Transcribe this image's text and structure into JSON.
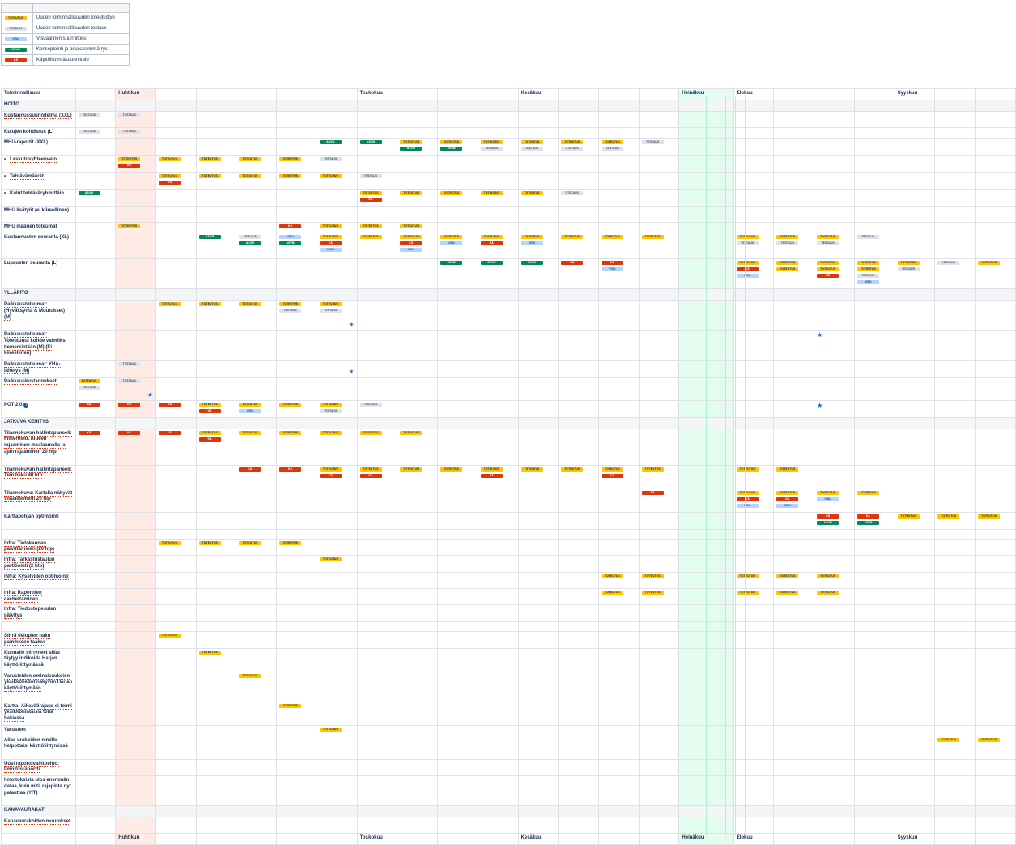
{
  "legend": [
    {
      "key": "T",
      "tag": "TOTEUTUS",
      "text": "Uuden toiminnallisuuden toteutustyö"
    },
    {
      "key": "S",
      "tag": "TESTAUS",
      "text": "Uuden toiminnallisuuden testaus"
    },
    {
      "key": "V",
      "tag": "VISU",
      "text": "Visuaalinen suunnittelu"
    },
    {
      "key": "A",
      "tag": "ASVM",
      "text": "Konseptointi ja asiakasymmärrys"
    },
    {
      "key": "K",
      "tag": "KÄ",
      "text": "Käyttöliittymäsuunnittelu"
    }
  ],
  "tags": {
    "T": "TOTEUTUS",
    "S": "TESTAUS",
    "V": "VISU",
    "A": "ASVM",
    "K": "KÄ"
  },
  "header": {
    "first_col": "Toiminnallisuus",
    "months": [
      "",
      "",
      "Huhtikuu",
      "",
      "",
      "",
      "",
      "",
      "Toukokuu",
      "",
      "",
      "",
      "Kesäkuu",
      "",
      "",
      "",
      "Heinäkuu",
      "Elokuu",
      "",
      "",
      "",
      "Syyskuu",
      "",
      ""
    ]
  },
  "rows": [
    {
      "type": "sec",
      "label": "HOITO"
    },
    {
      "label": "Kustannussuunnitelma (XXL)",
      "link": true,
      "h": 20,
      "cells": {
        "0": [
          "S"
        ],
        "1": [
          "S"
        ]
      }
    },
    {
      "label": "Kulujen kohdistus (L)",
      "h": 13,
      "cells": {
        "0": [
          "S"
        ],
        "1": [
          "S"
        ]
      }
    },
    {
      "label": "MHU-raportit (XXL)",
      "h": 20,
      "cells": {
        "6": [
          "A"
        ],
        "7": [
          "A"
        ],
        "8": [
          "T",
          "A"
        ],
        "9": [
          "T",
          "A"
        ],
        "10": [
          "T",
          "S"
        ],
        "11": [
          "T",
          "S"
        ],
        "12": [
          "T",
          "S"
        ],
        "13": [
          "T",
          "S"
        ],
        "14": [
          "S"
        ]
      }
    },
    {
      "label": "Laskutusyhteenveto",
      "link": true,
      "bullet": true,
      "h": 21,
      "cells": {
        "1": [
          "T",
          "K"
        ],
        "2": [
          "T"
        ],
        "3": [
          "T"
        ],
        "4": [
          "T"
        ],
        "5": [
          "T"
        ],
        "6": [
          "S"
        ]
      }
    },
    {
      "label": "Tehtävämäärät",
      "link": true,
      "bullet": true,
      "h": 21,
      "cells": {
        "2": [
          "T",
          "K"
        ],
        "3": [
          "T"
        ],
        "4": [
          "T"
        ],
        "5": [
          "T"
        ],
        "6": [
          "T"
        ],
        "7": [
          "S"
        ]
      }
    },
    {
      "label": "Kulut tehtäväryhmittäin",
      "bullet": true,
      "h": 21,
      "cells": {
        "0": [
          "A"
        ],
        "7": [
          "T",
          "K"
        ],
        "8": [
          "T"
        ],
        "9": [
          "T"
        ],
        "10": [
          "T"
        ],
        "11": [
          "T"
        ],
        "12": [
          "S"
        ]
      }
    },
    {
      "label": "MHU lisätyöt (ei kiireellinen)",
      "h": 20,
      "cells": {}
    },
    {
      "label": "MHU määrien toteumat",
      "h": 13,
      "cells": {
        "1": [
          "T"
        ],
        "5": [
          "K"
        ],
        "6": [
          "T"
        ],
        "7": [
          "T"
        ],
        "8": [
          "T"
        ]
      }
    },
    {
      "label": "Kustannusten seuranta (XL)",
      "h": 32,
      "cells": {
        "3": [
          "A"
        ],
        "4": [
          "S",
          "A"
        ],
        "5": [
          "V",
          "A"
        ],
        "6": [
          "T",
          "K",
          "V"
        ],
        "7": [
          "T"
        ],
        "8": [
          "T",
          "K",
          "V"
        ],
        "9": [
          "T",
          "V"
        ],
        "10": [
          "T",
          "K"
        ],
        "11": [
          "T",
          "V"
        ],
        "12": [
          "T"
        ],
        "13": [
          "T"
        ],
        "14": [
          "T"
        ],
        "16": [
          "T",
          "S"
        ],
        "17": [
          "T",
          "S"
        ],
        "18": [
          "T",
          "S"
        ],
        "19": [
          "S"
        ]
      }
    },
    {
      "label": "Lupausten seuranta (L)",
      "h": 37,
      "cells": {
        "9": [
          "A"
        ],
        "10": [
          "A"
        ],
        "11": [
          "A"
        ],
        "12": [
          "K"
        ],
        "13": [
          "K",
          "V"
        ],
        "16": [
          "T",
          "K",
          "V"
        ],
        "17": [
          "T",
          "T"
        ],
        "18": [
          "T",
          "T",
          "K"
        ],
        "19": [
          "T",
          "T",
          "S",
          "V"
        ],
        "20": [
          "T",
          "S"
        ],
        "21": [
          "S"
        ],
        "22": [
          "T"
        ]
      }
    },
    {
      "type": "sec",
      "label": "YLLÄPITO",
      "blue": true
    },
    {
      "label": "Paikkaustoteumat: (Hyväksyntä & Muutokset) (M)",
      "link": true,
      "h": 37,
      "cells": {
        "2": [
          "T"
        ],
        "3": [
          "T"
        ],
        "4": [
          "T"
        ],
        "5": [
          "T",
          "S"
        ],
        "6": [
          "T",
          "S"
        ]
      },
      "stars": [
        6
      ]
    },
    {
      "label": "Paikkaustoteumat: Toteutunut kohde valmiiksi tiemerkintään (M) (Ei kiireellinen)",
      "link": true,
      "h": 37,
      "cells": {},
      "stars": [
        18
      ]
    },
    {
      "label": "Paikkaustoteumat: YHA-lähetys (M)",
      "link": true,
      "h": 20,
      "cells": {
        "1": [
          "S"
        ]
      },
      "stars": [
        6
      ]
    },
    {
      "label": "Paikkauskustannukset",
      "link": true,
      "h": 29,
      "cells": {
        "0": [
          "T",
          "S"
        ],
        "1": [
          "S"
        ]
      },
      "stars": [
        1
      ]
    },
    {
      "label": "POT 2.0",
      "qmark": true,
      "h": 21,
      "cells": {
        "0": [
          "K"
        ],
        "1": [
          "K"
        ],
        "2": [
          "K"
        ],
        "3": [
          "T",
          "K"
        ],
        "4": [
          "T",
          "V"
        ],
        "5": [
          "T"
        ],
        "6": [
          "T",
          "S"
        ],
        "7": [
          "S"
        ]
      },
      "stars": [
        18
      ]
    },
    {
      "type": "sec",
      "label": "JATKUVA KEHITYS"
    },
    {
      "label": "Tilannekuvan hallintapaneeli: Filtteröinti. Alueen rajaaminen maalaamalla ja ajan rajaaminen 20 htp",
      "link": true,
      "h": 45,
      "cells": {
        "0": [
          "K"
        ],
        "1": [
          "K"
        ],
        "2": [
          "K"
        ],
        "3": [
          "T",
          "K"
        ],
        "4": [
          "T"
        ],
        "5": [
          "T"
        ],
        "6": [
          "T"
        ],
        "7": [
          "T"
        ],
        "8": [
          "T"
        ]
      }
    },
    {
      "label": "Tilannekuvan hallintapaneeli: Tien haku 40 htp",
      "link": true,
      "h": 29,
      "cells": {
        "4": [
          "K"
        ],
        "5": [
          "K"
        ],
        "6": [
          "T",
          "K"
        ],
        "7": [
          "T",
          "K"
        ],
        "8": [
          "T"
        ],
        "9": [
          "T"
        ],
        "10": [
          "T",
          "K"
        ],
        "11": [
          "T"
        ],
        "12": [
          "T"
        ],
        "13": [
          "T",
          "K"
        ],
        "14": [
          "T"
        ],
        "16": [
          "T"
        ],
        "17": [
          "T"
        ]
      }
    },
    {
      "label": "Tilannekuva: Kartalla näkyvät visualisoinnit 20 htp",
      "link": true,
      "h": 29,
      "cells": {
        "14": [
          "K"
        ],
        "16": [
          "T",
          "K",
          "V"
        ],
        "17": [
          "T",
          "K",
          "V"
        ],
        "18": [
          "T",
          "V"
        ],
        "19": [
          "T"
        ]
      }
    },
    {
      "label": "Karttapohjan optimointi",
      "h": 21,
      "cells": {
        "18": [
          "K",
          "A"
        ],
        "19": [
          "K",
          "A"
        ],
        "20": [
          "T"
        ],
        "21": [
          "T"
        ],
        "22": [
          "T"
        ]
      }
    },
    {
      "type": "blank",
      "h": 12
    },
    {
      "label": "Infra: Tietokannan päivittäminen (20 htp)",
      "link": true,
      "h": 20,
      "cells": {
        "2": [
          "T"
        ],
        "3": [
          "T"
        ],
        "4": [
          "T"
        ],
        "5": [
          "T"
        ]
      }
    },
    {
      "label": "Infra: Tarkastustaulun partitiointi (2 htp)",
      "link": true,
      "h": 20,
      "cells": {
        "6": [
          "T"
        ]
      }
    },
    {
      "label": "INfra: Kyselyiden optimointi",
      "link": true,
      "h": 20,
      "cells": {
        "13": [
          "T"
        ],
        "14": [
          "T"
        ],
        "16": [
          "T"
        ],
        "17": [
          "T"
        ],
        "18": [
          "T"
        ]
      }
    },
    {
      "label": "Infra: Raporttien cachettaminen",
      "link": true,
      "h": 20,
      "cells": {
        "13": [
          "T"
        ],
        "14": [
          "T"
        ],
        "16": [
          "T"
        ],
        "17": [
          "T"
        ],
        "18": [
          "T"
        ]
      }
    },
    {
      "label": "Infra: Tiedostopesulan päivitys",
      "link": true,
      "h": 20,
      "cells": {}
    },
    {
      "type": "blank",
      "h": 12
    },
    {
      "label": "Siirrä tielupien haku painikkeen taakse",
      "link": true,
      "h": 20,
      "cells": {
        "2": [
          "T"
        ]
      }
    },
    {
      "label": "Kunnalle siirtyneet sillat täytyy indikoida Harjan käyttöliittymässä",
      "h": 29,
      "cells": {
        "3": [
          "T"
        ]
      }
    },
    {
      "label": "Varusteiden ominaisuuksien yksikkötiedot näkyviin Harjan käyttöliittymään",
      "link": true,
      "h": 37,
      "cells": {
        "4": [
          "T"
        ]
      }
    },
    {
      "label": "Kartta: Aikavälirajaus ei toimi yksikköhintaisia töitä hakiessa",
      "link": true,
      "h": 29,
      "cells": {
        "5": [
          "T"
        ]
      }
    },
    {
      "label": "Varusteet",
      "h": 13,
      "cells": {
        "6": [
          "T"
        ]
      }
    },
    {
      "label": "Alias urakoiden nimille helpottaisi käyttöliittymissä",
      "h": 29,
      "cells": {
        "21": [
          "T"
        ],
        "22": [
          "T"
        ]
      }
    },
    {
      "label": "Uusi raporttivaihtoehto: Ilmoitusraportti",
      "link": true,
      "h": 20,
      "cells": {}
    },
    {
      "label": "Ilmoituksista ulos enemmän dataa, kuin mitä rajapinta nyt palauttaa (YIT)",
      "h": 37,
      "cells": {}
    },
    {
      "type": "sec",
      "label": "KANAVAURAKAT"
    },
    {
      "label": "Kanavaurakoiden muutokset",
      "link": true,
      "h": 20,
      "cells": {}
    },
    {
      "type": "foot"
    }
  ],
  "colors": {
    "pink": "#ffebe6",
    "green": "#e3fcef",
    "border": "#dfe1e6"
  }
}
